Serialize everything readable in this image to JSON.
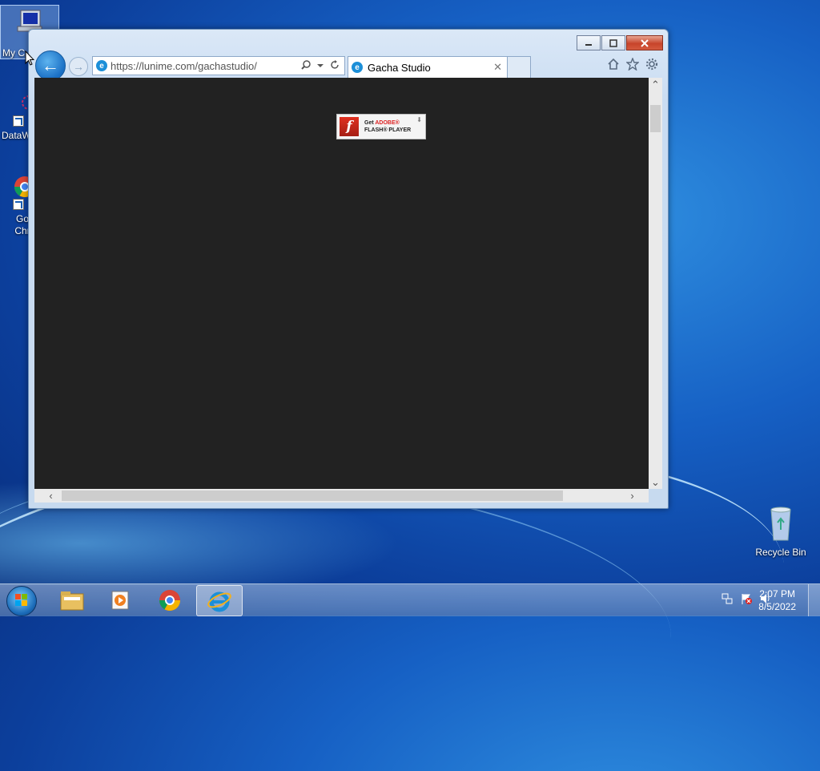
{
  "desktop": {
    "icons": [
      {
        "label": "My C"
      },
      {
        "label": "DataW"
      },
      {
        "label": "Go Chr"
      },
      {
        "label": "Recycle Bin"
      }
    ]
  },
  "browser": {
    "address_url": "https://lunime.com/gachastudio/",
    "tab_title": "Gacha Studio",
    "tab_close": "✕",
    "back_arrow": "←",
    "forward_arrow": "→",
    "flash_badge": {
      "line1_prefix": "Get",
      "line1_brand": "ADOBE®",
      "line2": "FLASH® PLAYER"
    }
  },
  "taskbar": {
    "pinned": [
      {
        "icon": "file-explorer-icon"
      },
      {
        "icon": "media-player-icon"
      },
      {
        "icon": "chrome-icon"
      },
      {
        "icon": "internet-explorer-icon",
        "active": true
      }
    ],
    "clock": {
      "time": "2:07 PM",
      "date": "8/5/2022"
    }
  }
}
